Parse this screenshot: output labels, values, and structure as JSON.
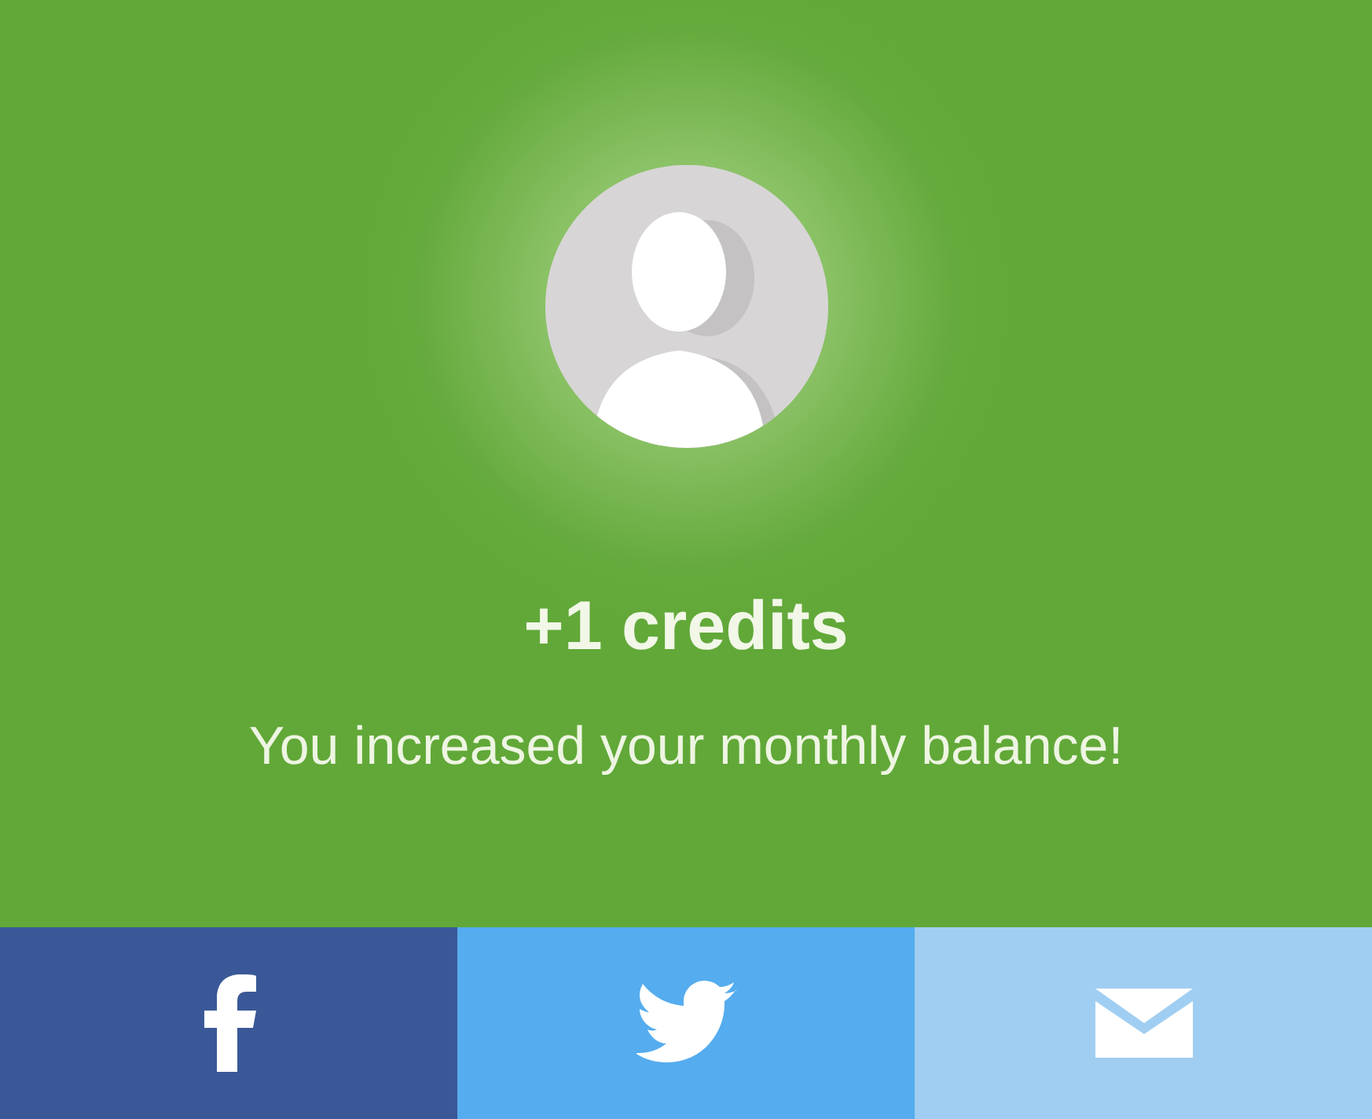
{
  "notification": {
    "title": "+1 credits",
    "message": "You increased your monthly balance!"
  },
  "share_buttons": [
    {
      "kind": "facebook"
    },
    {
      "kind": "twitter"
    },
    {
      "kind": "email"
    }
  ]
}
